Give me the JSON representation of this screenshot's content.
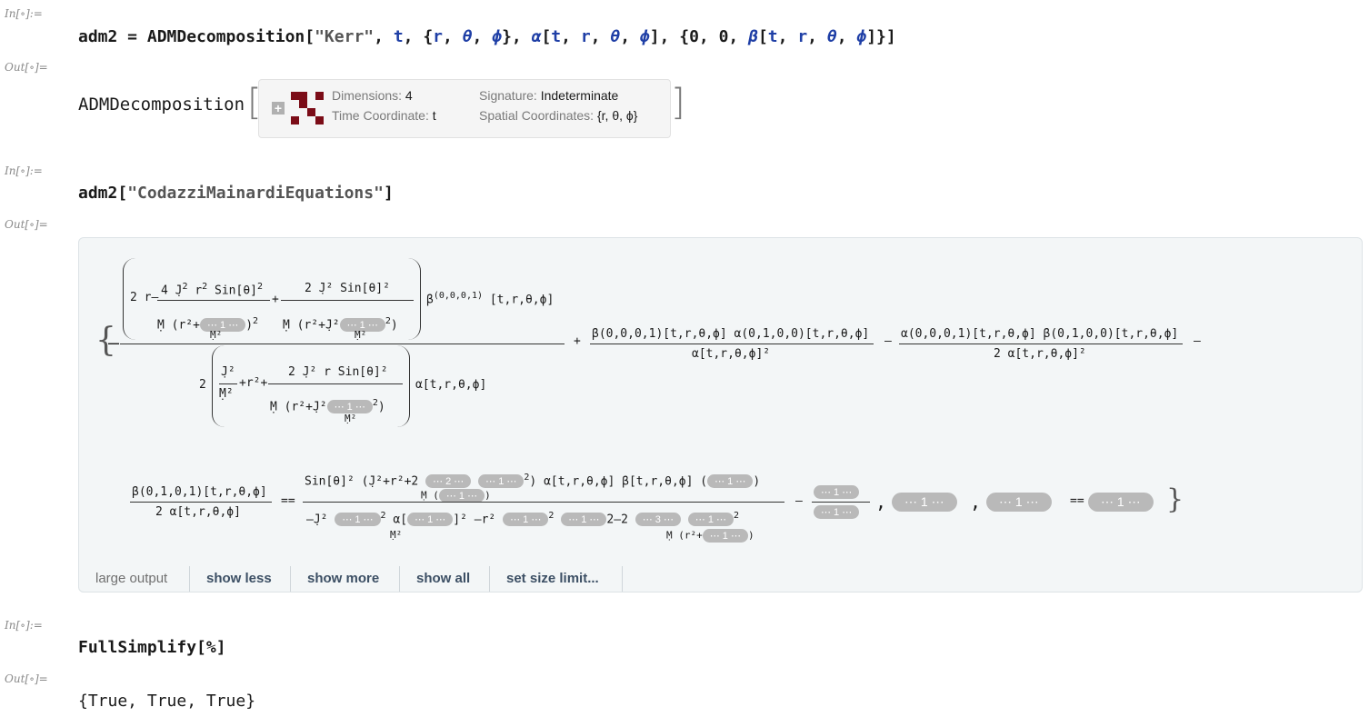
{
  "cells": {
    "in1_label": "In[∘]:=",
    "out1_label": "Out[∘]=",
    "in2_label": "In[∘]:=",
    "out2_label": "Out[∘]=",
    "in3_label": "In[∘]:=",
    "out3_label": "Out[∘]="
  },
  "input1": {
    "p1": "adm2 = ADMDecomposition[",
    "str": "\"Kerr\"",
    "p2": ", ",
    "t": "t",
    "p3": ", {",
    "r": "r",
    "p4": ", ",
    "theta": "θ",
    "p5": ", ",
    "phi": "ϕ",
    "p6": "}, ",
    "alpha": "α",
    "p7": "[",
    "t2": "t",
    "p8": ", ",
    "r2": "r",
    "p9": ", ",
    "theta2": "θ",
    "p10": ", ",
    "phi2": "ϕ",
    "p11": "], {0, 0, ",
    "beta": "β",
    "p12": "[",
    "t3": "t",
    "p13": ", ",
    "r3": "r",
    "p14": ", ",
    "theta3": "θ",
    "p15": ", ",
    "phi3": "ϕ",
    "p16": "]}]"
  },
  "output1": {
    "head": "ADMDecomposition",
    "dimensions_key": "Dimensions:",
    "dimensions_val": "4",
    "time_key": "Time Coordinate:",
    "time_val": "t",
    "signature_key": "Signature:",
    "signature_val": "Indeterminate",
    "spatial_key": "Spatial Coordinates:",
    "spatial_val": "{r, θ, ϕ}"
  },
  "input2": {
    "p1": "adm2[",
    "str": "\"CodazziMainardiEquations\"",
    "p2": "]"
  },
  "output2": {
    "t_open": "{–",
    "num1_a": "2 r–",
    "num1_b": "4 J̣",
    "num1_c": " r",
    "num1_d": " Sin[θ]",
    "num1_den": "Ṃ",
    "num1_rp": "r²+",
    "pill1": "⋯ 1 ⋯",
    "m2": "Ṃ²",
    "num1_e": "2 J̣² Sin[θ]²",
    "num1_rp2": "r²+",
    "j2": "J̣²",
    "pill2": "⋯ 1 ⋯",
    "beta_term": "β",
    "beta_sup": "(0,0,0,1)",
    "beta_args": "[t,r,θ,ϕ]",
    "den1_a": "2",
    "den1_j2": "J̣²",
    "den1_m2": "Ṃ²",
    "den1_b": "+r²+",
    "den1_c": "2 J̣² r Sin[θ]²",
    "den1_m": "Ṃ",
    "den1_rp": "r²+",
    "den1_pill": "⋯ 1 ⋯",
    "den1_alpha": "α[t,r,θ,ϕ]",
    "plus": "+",
    "t2_num": "β(0,0,0,1)[t,r,θ,ϕ] α(0,1,0,0)[t,r,θ,ϕ]",
    "t2_den": "α[t,r,θ,ϕ]²",
    "minus": "–",
    "t3_num": "α(0,0,0,1)[t,r,θ,ϕ] β(0,1,0,0)[t,r,θ,ϕ]",
    "t3_den": "2 α[t,r,θ,ϕ]²",
    "minus2": "–",
    "l2_num": "β(0,1,0,1)[t,r,θ,ϕ]",
    "l2_den": "2 α[t,r,θ,ϕ]",
    "eqeq": "==",
    "l2_rn_a": "Sin[θ]²",
    "l2_rn_b": "+r²+",
    "l2_pill_a": "⋯ 2 ⋯",
    "l2_pill_b": "⋯ 1 ⋯",
    "l2_pill_c": "⋯ 1 ⋯",
    "l2_rn_c": "α[t,r,θ,ϕ] β[t,r,θ,ϕ]",
    "l2_pill_d": "⋯ 1 ⋯",
    "l2_rd_a": "J̣²",
    "l2_pill_e": "⋯ 1 ⋯",
    "l2_rd_b": "α[",
    "l2_pill_f": "⋯ 1 ⋯",
    "l2_rd_c": "]²",
    "l2_rd_d": "–r²",
    "l2_pill_g": "⋯ 1 ⋯",
    "l2_pill_h": "⋯ 1 ⋯",
    "l2_rd_e": "2–",
    "l2_pill_i": "⋯ 3 ⋯",
    "l2_pill_j": "⋯ 1 ⋯",
    "l2_rd_f": "Ṃ",
    "l2_rd_g": "r²+",
    "l2_pill_k": "⋯ 1 ⋯",
    "l2_minus": "–",
    "l2_pill_l": "⋯ 1 ⋯",
    "l2_pill_m": "⋯ 1 ⋯",
    "comma": ",",
    "l2_pill_n": "⋯ 1 ⋯",
    "comma2": ",",
    "l2_pill_o": "⋯ 1 ⋯",
    "eqeq2": "==",
    "l2_pill_p": "⋯ 1 ⋯",
    "close": "}"
  },
  "output_bar": {
    "large_output": "large output",
    "show_less": "show less",
    "show_more": "show more",
    "show_all": "show all",
    "set_size_limit": "set size limit..."
  },
  "input3": {
    "text": "FullSimplify[%]"
  },
  "output3": {
    "text": "{True, True, True}"
  }
}
